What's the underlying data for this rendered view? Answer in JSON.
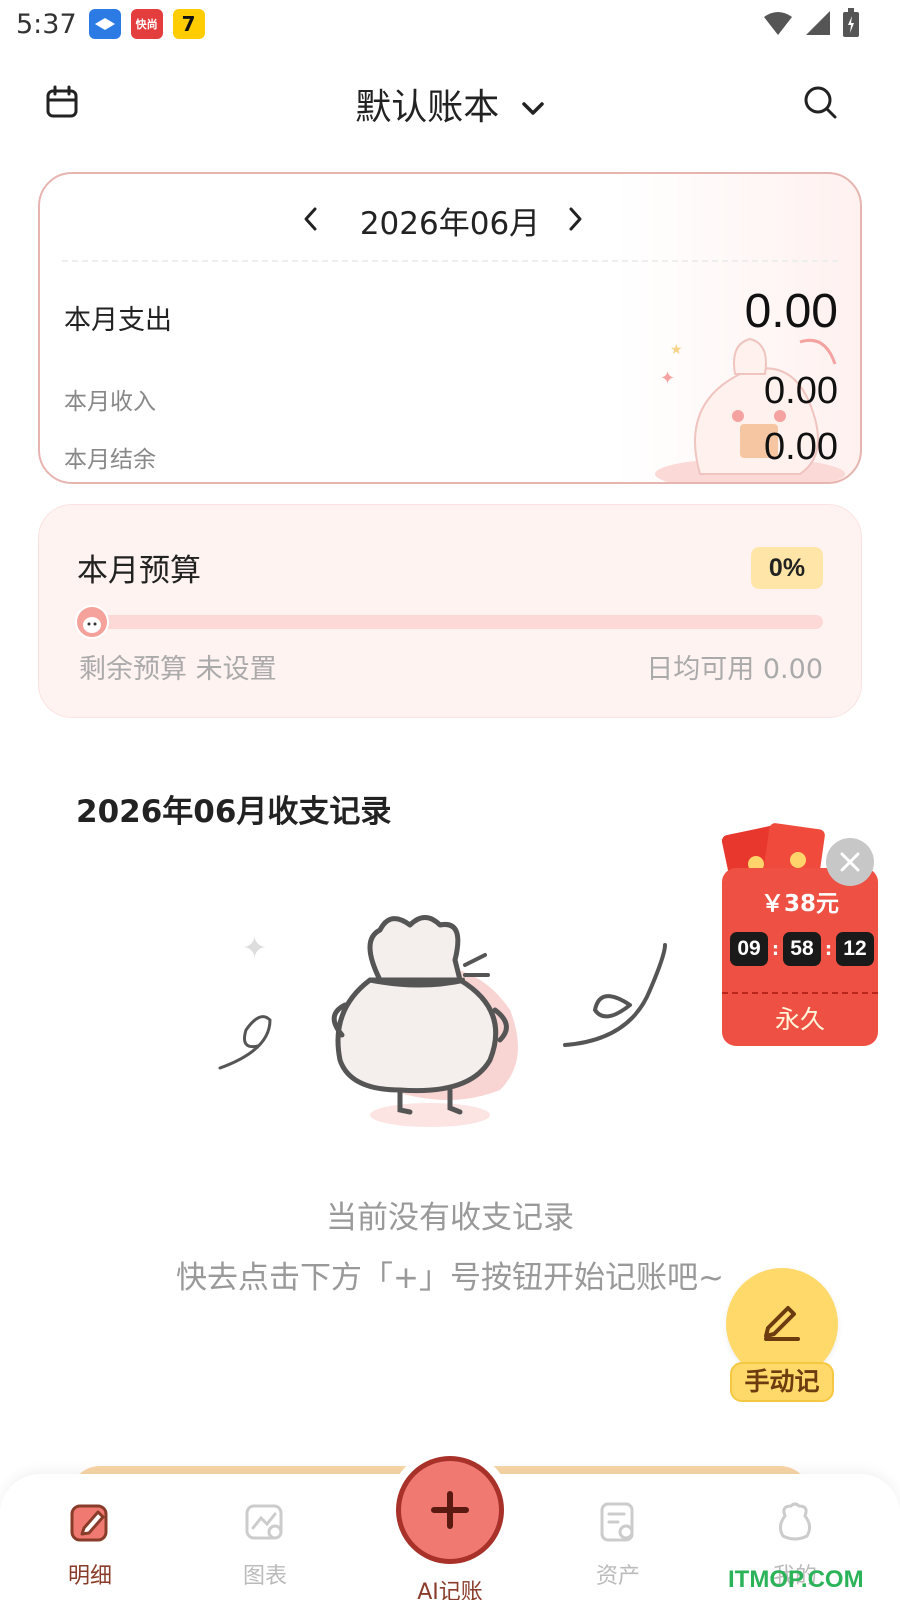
{
  "status_bar": {
    "time": "5:37",
    "apps": [
      {
        "name": "app-icon-1",
        "label": "",
        "color": "#2c7be5"
      },
      {
        "name": "app-icon-2",
        "label": "快尚",
        "color": "#e43d3d"
      },
      {
        "name": "app-icon-3",
        "label": "7",
        "color": "#ffcc00"
      }
    ],
    "icons": [
      "wifi-icon",
      "signal-icon",
      "battery-icon"
    ]
  },
  "header": {
    "title": "默认账本",
    "left_icon": "calendar-icon",
    "right_icon": "search-icon"
  },
  "summary": {
    "month": "2026年06月",
    "expense_label": "本月支出",
    "expense_value": "0.00",
    "income_label": "本月收入",
    "income_value": "0.00",
    "balance_label": "本月结余",
    "balance_value": "0.00"
  },
  "budget": {
    "title": "本月预算",
    "percent": "0%",
    "progress": 0,
    "remaining": "剩余预算 未设置",
    "daily": "日均可用 0.00"
  },
  "records": {
    "title": "2026年06月收支记录",
    "empty_line1": "当前没有收支记录",
    "empty_line2": "快去点击下方「+」号按钮开始记账吧~"
  },
  "promo": {
    "amount": "￥38元",
    "timer": [
      "09",
      "58",
      "12"
    ],
    "forever": "永久"
  },
  "manual_fab": {
    "label": "手动记"
  },
  "nav": {
    "items": [
      {
        "label": "明细",
        "icon": "detail-icon",
        "active": true
      },
      {
        "label": "图表",
        "icon": "chart-icon",
        "active": false
      },
      {
        "label": "资产",
        "icon": "assets-icon",
        "active": false
      },
      {
        "label": "我的",
        "icon": "profile-icon",
        "active": false
      }
    ],
    "center_label": "AI记账"
  },
  "watermark": "ITMOP.COM",
  "colors": {
    "accent": "#f07a72",
    "accent_dark": "#a8322a",
    "budget_bg": "#fff3f2",
    "badge": "#ffe6a8",
    "fab_yellow": "#ffd96a",
    "promo_red": "#ee5043",
    "watermark_green": "#2bb35a"
  }
}
